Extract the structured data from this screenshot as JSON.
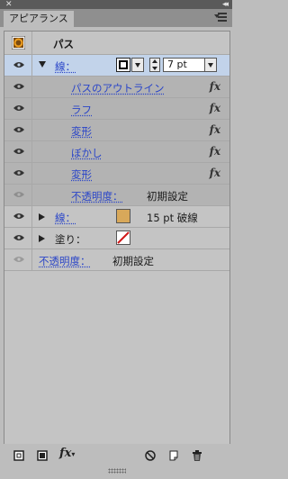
{
  "window": {
    "close_glyph": "✕",
    "collapse_glyph": "◂◂"
  },
  "tab": {
    "label": "アピアランス"
  },
  "header": {
    "title": "パス",
    "icon": "path-target-icon"
  },
  "stroke_main": {
    "label": "線：",
    "weight": "7 pt",
    "swatch_color": "#000000"
  },
  "effects": [
    {
      "label": "パスのアウトライン",
      "fx": "fx"
    },
    {
      "label": "ラフ",
      "fx": "fx"
    },
    {
      "label": "変形",
      "fx": "fx"
    },
    {
      "label": "ぼかし",
      "fx": "fx"
    },
    {
      "label": "変形",
      "fx": "fx"
    }
  ],
  "opacity_sub": {
    "label": "不透明度：",
    "value": "初期設定"
  },
  "stroke_2": {
    "label": "線：",
    "value": "15 pt 破線",
    "swatch_color": "#d8a85a"
  },
  "fill": {
    "label": "塗り：",
    "swatch": "none-swatch"
  },
  "opacity_main": {
    "label": "不透明度：",
    "value": "初期設定"
  },
  "bottom_icons": [
    "new-stroke-icon",
    "new-fill-icon",
    "fx-menu-icon",
    "clear-appearance-icon",
    "duplicate-item-icon",
    "delete-item-icon"
  ],
  "fx_menu_label": "fx"
}
